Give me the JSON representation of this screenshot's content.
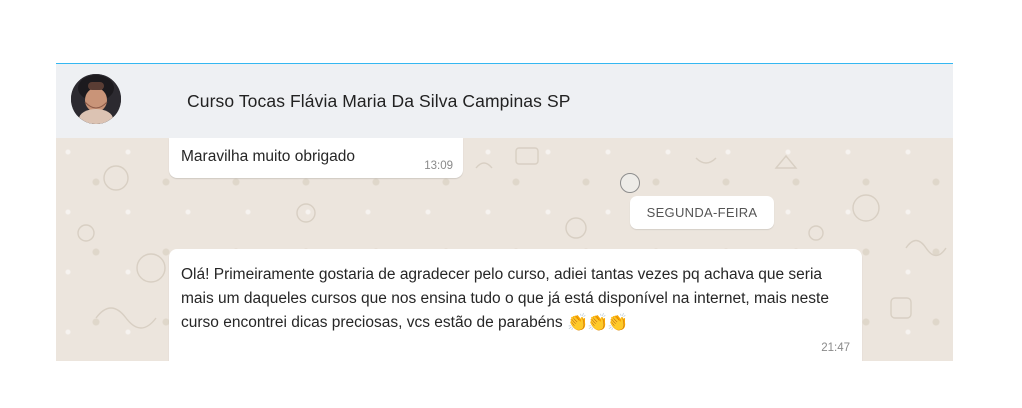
{
  "header": {
    "title": "Curso Tocas Flávia Maria Da Silva Campinas SP",
    "avatar": "contact-avatar"
  },
  "messages": [
    {
      "text": "Maravilha muito obrigado",
      "time": "13:09"
    },
    {
      "text": "Olá! Primeiramente gostaria de agradecer pelo curso, adiei tantas vezes pq achava que seria mais um daqueles cursos que nos ensina tudo o que já está disponível na internet, mais neste curso encontrei dicas preciosas, vcs estão de parabéns",
      "emoji": "👏👏👏",
      "time": "21:47"
    }
  ],
  "date_divider": "SEGUNDA-FEIRA",
  "colors": {
    "header_bg": "#eef0f3",
    "chat_bg": "#ece5dd",
    "bubble_bg": "#ffffff",
    "accent_line": "#34b7f1",
    "time_text": "#8a8a8a"
  },
  "icons": {
    "scroll_indicator": "circle-icon",
    "emoji": "clapping-hands-icon"
  }
}
